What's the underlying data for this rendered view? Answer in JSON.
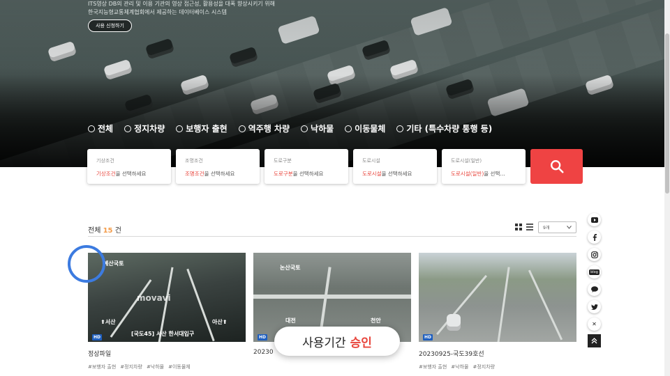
{
  "hero": {
    "desc_line1": "ITS영상 DB의 관리 및 이용 기관의 영상 접근성, 활용성을 대폭 향상시키기 위해",
    "desc_line2": "한국지능형교통체계협회에서 제공하는 데이터베이스 시스템",
    "apply_button": "사용 신청하기"
  },
  "filters": [
    "전체",
    "정지차량",
    "보행자 출현",
    "역주행 차량",
    "낙하물",
    "이동물체",
    "기타 (특수차량 통행 등)"
  ],
  "fields": [
    {
      "label": "기상조건",
      "hint_red": "기상조건",
      "hint_rest": "을 선택하세요"
    },
    {
      "label": "조명조건",
      "hint_red": "조명조건",
      "hint_rest": "을 선택하세요"
    },
    {
      "label": "도로구분",
      "hint_red": "도로구분",
      "hint_rest": "을 선택하세요"
    },
    {
      "label": "도로시설",
      "hint_red": "도로시설",
      "hint_rest": "을 선택하세요"
    },
    {
      "label": "도로시설(일반)",
      "hint_red": "도로시설(일반)",
      "hint_rest": "을 선택…"
    }
  ],
  "results": {
    "total_prefix": "전체",
    "total_count": "15",
    "total_suffix": "건",
    "sort_value": "9개"
  },
  "cards": [
    {
      "title": "정상파일",
      "badge": "HD",
      "tags": [
        "#보행자 출현",
        "#정지차량",
        "#낙하물",
        "#이동물체"
      ],
      "cap_top": "예산국토",
      "cap_left": "⬆서산",
      "cap_right": "아산⬆",
      "cap_bottom": "[국도45] 서산 한서대입구",
      "watermark": "movavi"
    },
    {
      "title": "20230",
      "badge": "HD",
      "tags": [],
      "cap_top": "논산국토",
      "cap_left": "대전",
      "cap_right": "천안"
    },
    {
      "title": "20230925-국도39호선",
      "badge": "HD",
      "tags": [
        "#보행자 출현",
        "#낙하물",
        "#정지차량"
      ]
    }
  ],
  "toast": {
    "text": "사용기간",
    "accent": "승인"
  },
  "side_icons": [
    "youtube-icon",
    "facebook-icon",
    "instagram-icon",
    "blog-icon",
    "talk-icon",
    "twitter-icon",
    "close-icon"
  ],
  "side_labels": {
    "blog": "blog",
    "close": "✕"
  },
  "colors": {
    "accent_red": "#ef4343",
    "count_orange": "#f39c4a",
    "hd_blue": "#1f5fbf",
    "cursor_ring": "#3c7be0"
  }
}
